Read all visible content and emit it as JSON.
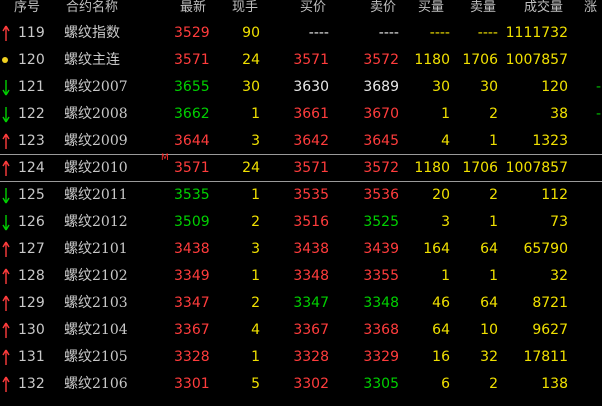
{
  "colors": {
    "up": "#ff3c3c",
    "down": "#00d000",
    "neutral": "#e8e8e8",
    "vol": "#f0e000",
    "text": "#c8c8c8",
    "header": "#c0c0c0"
  },
  "columns": [
    "序号",
    "合约名称",
    "最新",
    "现手",
    "买价",
    "卖价",
    "买量",
    "卖量",
    "成交量",
    "涨"
  ],
  "rows": [
    {
      "dir": "up",
      "seq": "119",
      "name": "螺纹指数",
      "latest": "3529",
      "lc": "up",
      "hand": "90",
      "bid": "----",
      "bc": "neutral",
      "ask": "----",
      "ac": "neutral",
      "bidv": "----",
      "askv": "----",
      "vol": "1111732",
      "edge": ""
    },
    {
      "dir": "dot",
      "seq": "120",
      "name": "螺纹主连",
      "latest": "3571",
      "lc": "up",
      "hand": "24",
      "bid": "3571",
      "bc": "up",
      "ask": "3572",
      "ac": "up",
      "bidv": "1180",
      "askv": "1706",
      "vol": "1007857",
      "edge": ""
    },
    {
      "dir": "down",
      "seq": "121",
      "name": "螺纹2007",
      "latest": "3655",
      "lc": "down",
      "hand": "30",
      "bid": "3630",
      "bc": "neutral",
      "ask": "3689",
      "ac": "neutral",
      "bidv": "30",
      "askv": "30",
      "vol": "120",
      "edge": "-"
    },
    {
      "dir": "down",
      "seq": "122",
      "name": "螺纹2008",
      "latest": "3662",
      "lc": "down",
      "hand": "1",
      "bid": "3661",
      "bc": "up",
      "ask": "3670",
      "ac": "up",
      "bidv": "1",
      "askv": "2",
      "vol": "38",
      "edge": "-"
    },
    {
      "dir": "up",
      "seq": "123",
      "name": "螺纹2009",
      "latest": "3644",
      "lc": "up",
      "hand": "3",
      "bid": "3642",
      "bc": "up",
      "ask": "3645",
      "ac": "up",
      "bidv": "4",
      "askv": "1",
      "vol": "1323",
      "edge": ""
    },
    {
      "dir": "up",
      "seq": "124",
      "name": "螺纹2010",
      "mark": "M",
      "latest": "3571",
      "lc": "up",
      "hand": "24",
      "bid": "3571",
      "bc": "up",
      "ask": "3572",
      "ac": "up",
      "bidv": "1180",
      "askv": "1706",
      "vol": "1007857",
      "edge": ""
    },
    {
      "dir": "down",
      "seq": "125",
      "name": "螺纹2011",
      "latest": "3535",
      "lc": "down",
      "hand": "1",
      "bid": "3535",
      "bc": "up",
      "ask": "3536",
      "ac": "up",
      "bidv": "20",
      "askv": "2",
      "vol": "112",
      "edge": ""
    },
    {
      "dir": "down",
      "seq": "126",
      "name": "螺纹2012",
      "latest": "3509",
      "lc": "down",
      "hand": "2",
      "bid": "3516",
      "bc": "up",
      "ask": "3525",
      "ac": "down",
      "bidv": "3",
      "askv": "1",
      "vol": "73",
      "edge": ""
    },
    {
      "dir": "up",
      "seq": "127",
      "name": "螺纹2101",
      "latest": "3438",
      "lc": "up",
      "hand": "3",
      "bid": "3438",
      "bc": "up",
      "ask": "3439",
      "ac": "up",
      "bidv": "164",
      "askv": "64",
      "vol": "65790",
      "edge": ""
    },
    {
      "dir": "up",
      "seq": "128",
      "name": "螺纹2102",
      "latest": "3349",
      "lc": "up",
      "hand": "1",
      "bid": "3348",
      "bc": "up",
      "ask": "3355",
      "ac": "up",
      "bidv": "1",
      "askv": "1",
      "vol": "32",
      "edge": ""
    },
    {
      "dir": "up",
      "seq": "129",
      "name": "螺纹2103",
      "latest": "3347",
      "lc": "up",
      "hand": "2",
      "bid": "3347",
      "bc": "down",
      "ask": "3348",
      "ac": "down",
      "bidv": "46",
      "askv": "64",
      "vol": "8721",
      "edge": ""
    },
    {
      "dir": "up",
      "seq": "130",
      "name": "螺纹2104",
      "latest": "3367",
      "lc": "up",
      "hand": "4",
      "bid": "3367",
      "bc": "up",
      "ask": "3368",
      "ac": "up",
      "bidv": "64",
      "askv": "10",
      "vol": "9627",
      "edge": ""
    },
    {
      "dir": "up",
      "seq": "131",
      "name": "螺纹2105",
      "latest": "3328",
      "lc": "up",
      "hand": "1",
      "bid": "3328",
      "bc": "up",
      "ask": "3329",
      "ac": "up",
      "bidv": "16",
      "askv": "32",
      "vol": "17811",
      "edge": ""
    },
    {
      "dir": "up",
      "seq": "132",
      "name": "螺纹2106",
      "latest": "3301",
      "lc": "up",
      "hand": "5",
      "bid": "3302",
      "bc": "up",
      "ask": "3305",
      "ac": "down",
      "bidv": "6",
      "askv": "2",
      "vol": "138",
      "edge": ""
    }
  ]
}
